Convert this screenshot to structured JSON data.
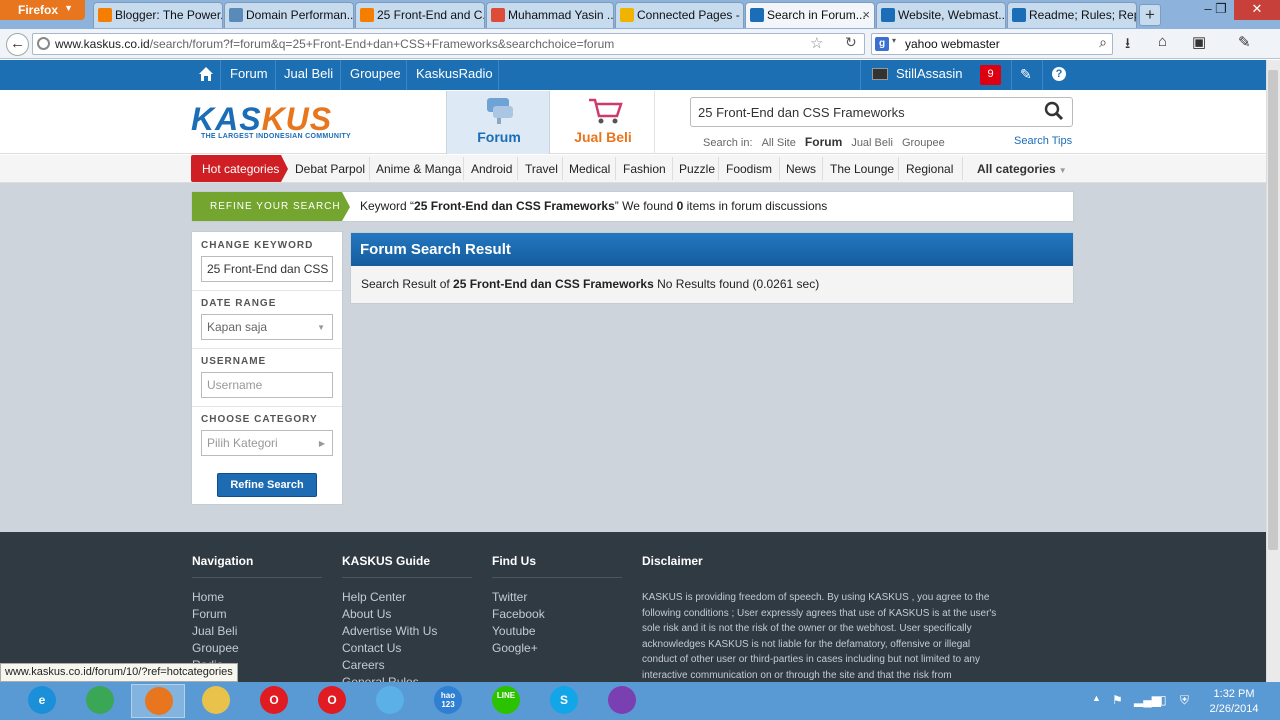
{
  "browser": {
    "menu_label": "Firefox",
    "tabs": [
      {
        "label": "Blogger: The Power...",
        "icon": "blogger-icon",
        "color": "#f57d00"
      },
      {
        "label": "Domain Performan...",
        "icon": "page-icon",
        "color": "#5a8ab8"
      },
      {
        "label": "25 Front-End and C...",
        "icon": "blogger-icon",
        "color": "#f57d00"
      },
      {
        "label": "Muhammad Yasin ...",
        "icon": "google-plus-icon",
        "color": "#dd4b39"
      },
      {
        "label": "Connected Pages - ...",
        "icon": "bing-icon",
        "color": "#f0b400"
      },
      {
        "label": "Search in Forum...",
        "icon": "kaskus-icon",
        "color": "#1a6db6"
      },
      {
        "label": "Website, Webmast...",
        "icon": "kaskus-icon",
        "color": "#1a6db6"
      },
      {
        "label": "Readme; Rules; Rep...",
        "icon": "kaskus-icon",
        "color": "#1a6db6"
      }
    ],
    "url_host": "www.kaskus.co.id",
    "url_path": "/search/forum?f=forum&q=25+Front-End+dan+CSS+Frameworks&searchchoice=forum",
    "search_value": "yahoo webmaster",
    "status_url": "www.kaskus.co.id/forum/10/?ref=hotcategories"
  },
  "kaskus": {
    "topnav": [
      "Forum",
      "Jual Beli",
      "Groupee",
      "KaskusRadio"
    ],
    "username": "StillAssasin",
    "notif_count": "9",
    "logo_text_1": "KAS",
    "logo_text_2": "KUS",
    "logo_tagline": "THE LARGEST INDONESIAN COMMUNITY",
    "tab_forum": "Forum",
    "tab_jualbeli": "Jual Beli",
    "search_value": "25 Front-End dan CSS Frameworks",
    "search_in_label": "Search in:",
    "search_in": [
      "All Site",
      "Forum",
      "Jual Beli",
      "Groupee"
    ],
    "search_tips": "Search Tips",
    "hot_categories": "Hot categories",
    "categories": [
      "Debat Parpol",
      "Anime & Manga",
      "Android",
      "Travel",
      "Medical",
      "Fashion",
      "Puzzle",
      "Foodism",
      "News",
      "The Lounge",
      "Regional"
    ],
    "all_categories": "All categories"
  },
  "refine": {
    "label": "REFINE YOUR SEARCH",
    "text_pre": "Keyword “",
    "keyword": "25 Front-End dan CSS Frameworks",
    "text_mid": "” We found ",
    "count": "0",
    "text_post": " items in forum discussions"
  },
  "sidebar": {
    "change_keyword": "CHANGE KEYWORD",
    "keyword_value": "25 Front-End dan CSS Frameworks",
    "date_range": "DATE RANGE",
    "date_value": "Kapan saja",
    "username": "USERNAME",
    "username_placeholder": "Username",
    "choose_category": "CHOOSE CATEGORY",
    "category_placeholder": "Pilih Kategori",
    "button": "Refine Search"
  },
  "result": {
    "title": "Forum Search Result",
    "pre": "Search Result of ",
    "keyword": "25 Front-End dan CSS Frameworks",
    "post": " No Results found (0.0261 sec)"
  },
  "footer": {
    "navigation": {
      "title": "Navigation",
      "links": [
        "Home",
        "Forum",
        "Jual Beli",
        "Groupee",
        "Radio"
      ]
    },
    "guide": {
      "title": "KASKUS Guide",
      "links": [
        "Help Center",
        "About Us",
        "Advertise With Us",
        "Contact Us",
        "Careers",
        "General Rules"
      ]
    },
    "findus": {
      "title": "Find Us",
      "links": [
        "Twitter",
        "Facebook",
        "Youtube",
        "Google+"
      ]
    },
    "disclaimer": {
      "title": "Disclaimer",
      "text": "KASKUS is providing freedom of speech. By using KASKUS , you agree to the following conditions ; User expressly agrees that use of KASKUS is at the user's sole risk and it is not the risk of the owner or the webhost. User specifically acknowledges KASKUS is not liable for the defamatory, offensive or illegal conduct of other user or third-parties in cases including but not limited to any interactive communication on or through the site and that the risk from"
    }
  },
  "taskbar": {
    "apps": [
      {
        "name": "internet-explorer",
        "color": "#1b8fd8",
        "label": "e"
      },
      {
        "name": "chrome",
        "color": "#3aa757",
        "label": ""
      },
      {
        "name": "firefox",
        "color": "#e8761e",
        "label": ""
      },
      {
        "name": "file-explorer",
        "color": "#e8c24a",
        "label": ""
      },
      {
        "name": "opera",
        "color": "#e01b22",
        "label": "O"
      },
      {
        "name": "opera-next",
        "color": "#e01b22",
        "label": "O"
      },
      {
        "name": "safari",
        "color": "#5bb0e8",
        "label": ""
      },
      {
        "name": "hao123",
        "color": "#2f7fd3",
        "label": "hao\n123"
      },
      {
        "name": "line",
        "color": "#2bc200",
        "label": "LINE"
      },
      {
        "name": "skype",
        "color": "#12a5e8",
        "label": "S"
      },
      {
        "name": "yahoo-messenger",
        "color": "#7a3fb0",
        "label": ""
      }
    ],
    "time": "1:32 PM",
    "date": "2/26/2014"
  },
  "colors": {
    "kaskus_blue": "#1c6fb3",
    "kaskus_orange": "#e8761e",
    "hot_red": "#cf1f25",
    "refine_green": "#74a52f"
  }
}
